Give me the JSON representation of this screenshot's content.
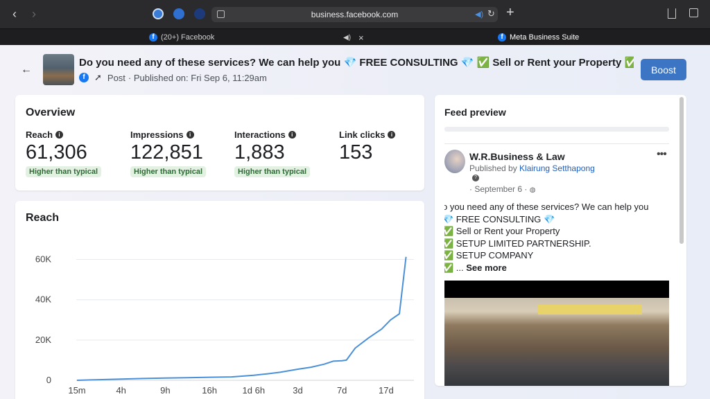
{
  "browser": {
    "url": "business.facebook.com",
    "tabs": [
      {
        "label": "(20+) Facebook"
      },
      {
        "label": "Meta Business Suite"
      }
    ],
    "tab_close": "×"
  },
  "post": {
    "title": "Do you need any of these services? We can help you 💎 FREE CONSULTING 💎 ✅ Sell or Rent your Property ✅ ...",
    "type_label": "Post",
    "published": "· Published on: Fri Sep 6, 11:29am",
    "boost_label": "Boost"
  },
  "overview": {
    "title": "Overview",
    "metrics": [
      {
        "label": "Reach",
        "value": "61,306",
        "badge": "Higher than typical"
      },
      {
        "label": "Impressions",
        "value": "122,851",
        "badge": "Higher than typical"
      },
      {
        "label": "Interactions",
        "value": "1,883",
        "badge": "Higher than typical"
      },
      {
        "label": "Link clicks",
        "value": "153",
        "badge": ""
      }
    ]
  },
  "reach_chart": {
    "title": "Reach",
    "chart_data": {
      "type": "line",
      "title": "Reach",
      "x_ticks": [
        "15m",
        "4h",
        "9h",
        "16h",
        "1d 6h",
        "3d",
        "7d",
        "17d"
      ],
      "y_ticks": [
        "0",
        "20K",
        "40K",
        "60K"
      ],
      "ylim": [
        0,
        65000
      ],
      "grid": true,
      "color": "#4a90d9",
      "series": [
        {
          "x_index": [
            0,
            0.5,
            1,
            1.5,
            2,
            2.5,
            3,
            3.5,
            4,
            4.3,
            4.6,
            5,
            5.3,
            5.6,
            5.8,
            6,
            6.1,
            6.3,
            6.6,
            6.9,
            7.1,
            7.3,
            7.45
          ],
          "values": [
            0,
            300,
            600,
            900,
            1100,
            1300,
            1500,
            1700,
            2500,
            3200,
            4000,
            5500,
            6500,
            8000,
            9500,
            9700,
            10000,
            16000,
            21000,
            25500,
            30000,
            33000,
            61306
          ]
        }
      ]
    }
  },
  "feed_preview": {
    "title": "Feed preview",
    "page_name": "W.R.Business & Law",
    "published_by_prefix": "Published by ",
    "author": "Klairung Setthapong",
    "help": "?",
    "date": "· September 6 ·",
    "more": "•••",
    "lines": [
      "o you need any of these services? We can help you",
      "💎 FREE CONSULTING 💎",
      "✅ Sell or Rent your Property",
      "✅ SETUP LIMITED PARTNERSHIP.",
      "✅ SETUP COMPANY"
    ],
    "ellipsis": "✅ ...",
    "see_more": "See more"
  }
}
